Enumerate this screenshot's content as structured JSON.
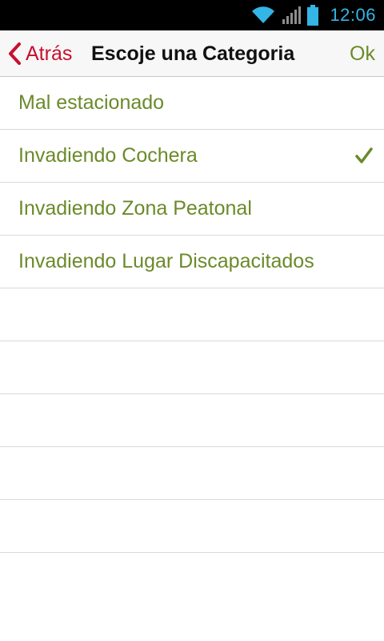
{
  "status_bar": {
    "time": "12:06",
    "icons": [
      "wifi-icon",
      "signal-icon",
      "battery-icon"
    ],
    "accent_color": "#33b5e5"
  },
  "nav": {
    "back_label": "Atrás",
    "title": "Escoje una Categoria",
    "ok_label": "Ok",
    "back_color": "#c8102e",
    "accent_color": "#6b8a2a"
  },
  "categories": [
    {
      "label": "Mal estacionado",
      "selected": false
    },
    {
      "label": "Invadiendo Cochera",
      "selected": true
    },
    {
      "label": "Invadiendo Zona Peatonal",
      "selected": false
    },
    {
      "label": "Invadiendo Lugar Discapacitados",
      "selected": false
    }
  ],
  "empty_rows": 5
}
